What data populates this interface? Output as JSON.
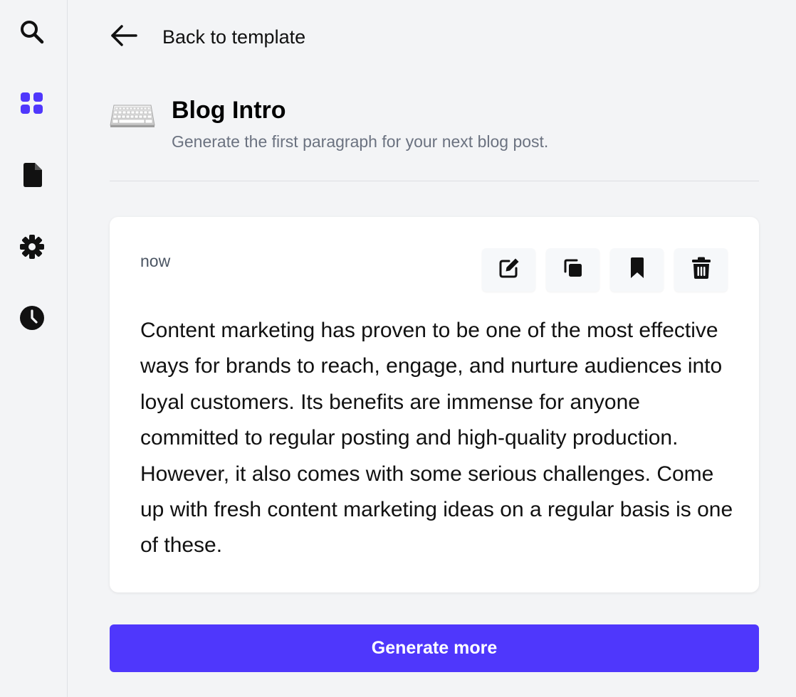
{
  "sidebar": {
    "items": [
      {
        "icon": "search-icon",
        "active": false
      },
      {
        "icon": "dashboard-grid-icon",
        "active": true
      },
      {
        "icon": "document-icon",
        "active": false
      },
      {
        "icon": "gear-icon",
        "active": false
      },
      {
        "icon": "clock-icon",
        "active": false
      }
    ],
    "active_color": "#4f37fc"
  },
  "header": {
    "back_label": "Back to template"
  },
  "template": {
    "icon": "keyboard-icon",
    "title": "Blog Intro",
    "description": "Generate the first paragraph for your next blog post."
  },
  "result": {
    "timestamp": "now",
    "actions": [
      {
        "icon": "edit-icon"
      },
      {
        "icon": "copy-icon"
      },
      {
        "icon": "bookmark-icon"
      },
      {
        "icon": "trash-icon"
      }
    ],
    "text": "Content marketing has proven to be one of the most effective ways for brands to reach, engage, and nurture audiences into loyal customers. Its benefits are immense for anyone committed to regular posting and high-quality production. However, it also comes with some serious challenges. Come up with fresh content marketing ideas on a regular basis is one of these."
  },
  "footer": {
    "generate_label": "Generate more",
    "button_color": "#4f37fc"
  }
}
